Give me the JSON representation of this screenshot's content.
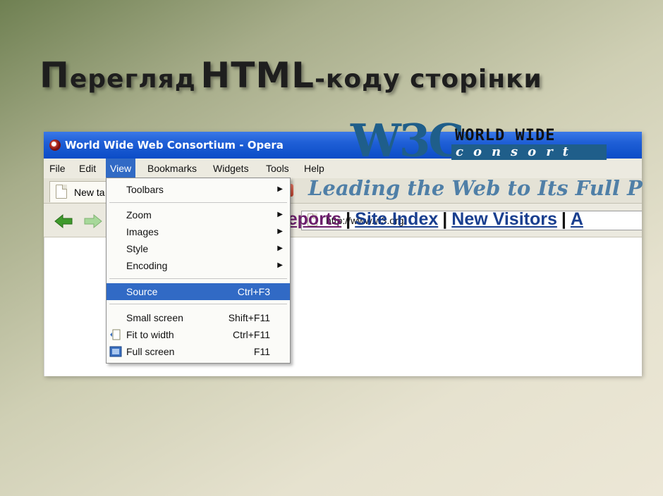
{
  "slide": {
    "title_cap": "П",
    "title_rest": "ерегляд",
    "title_html": "HTML",
    "title_suffix": "-коду сторінки"
  },
  "browser": {
    "window_title": "World Wide Web Consortium - Opera",
    "menu": [
      "File",
      "Edit",
      "View",
      "Bookmarks",
      "Widgets",
      "Tools",
      "Help"
    ],
    "active_menu": "View",
    "tab_label": "New ta",
    "address": "http://www.w3.org/"
  },
  "view_menu": {
    "items": [
      {
        "label": "Toolbars",
        "submenu": true
      },
      {
        "label": "Zoom",
        "submenu": true
      },
      {
        "label": "Images",
        "submenu": true
      },
      {
        "label": "Style",
        "submenu": true
      },
      {
        "label": "Encoding",
        "submenu": true
      },
      {
        "label": "Source",
        "shortcut": "Ctrl+F3",
        "highlighted": true
      },
      {
        "label": "Small screen",
        "shortcut": "Shift+F11"
      },
      {
        "label": "Fit to width",
        "shortcut": "Ctrl+F11"
      },
      {
        "label": "Full screen",
        "shortcut": "F11"
      }
    ]
  },
  "page": {
    "logo_text": "W3C",
    "logo_reg": "®",
    "world_wide": "WORLD WIDE",
    "consortium": "consort",
    "tagline": "Leading the Web to Its Full P",
    "links": [
      "cal Reports",
      "Site Index",
      "New Visitors",
      "A"
    ],
    "separator": "|"
  },
  "colors": {
    "titlebar": "#0b4cc7",
    "menu_highlight": "#316ac5",
    "w3c_blue": "#1f5e8a",
    "link_purple": "#6b1e6b",
    "link_blue": "#1a3f8f"
  }
}
